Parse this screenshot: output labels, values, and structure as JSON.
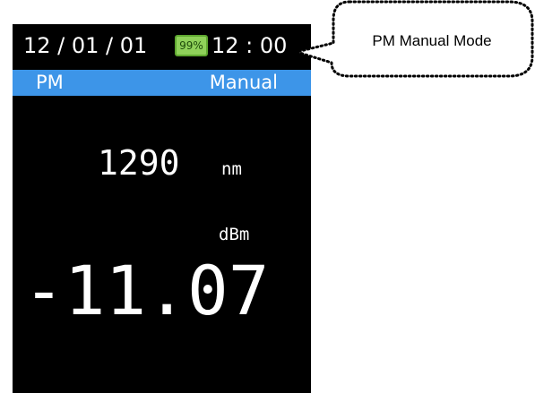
{
  "status_bar": {
    "date": "12 / 01 / 01",
    "battery": "99%",
    "time": "12 : 00"
  },
  "mode_bar": {
    "function": "PM",
    "mode": "Manual"
  },
  "measurement": {
    "wavelength": "1290",
    "wavelength_unit": "nm",
    "power_unit": "dBm",
    "power": "-11.07"
  },
  "callout": {
    "text": "PM Manual Mode"
  },
  "colors": {
    "screen_background": "#000000",
    "mode_bar_background": "#3d95e8",
    "battery_fill": "#8fd15a",
    "text": "#ffffff"
  }
}
